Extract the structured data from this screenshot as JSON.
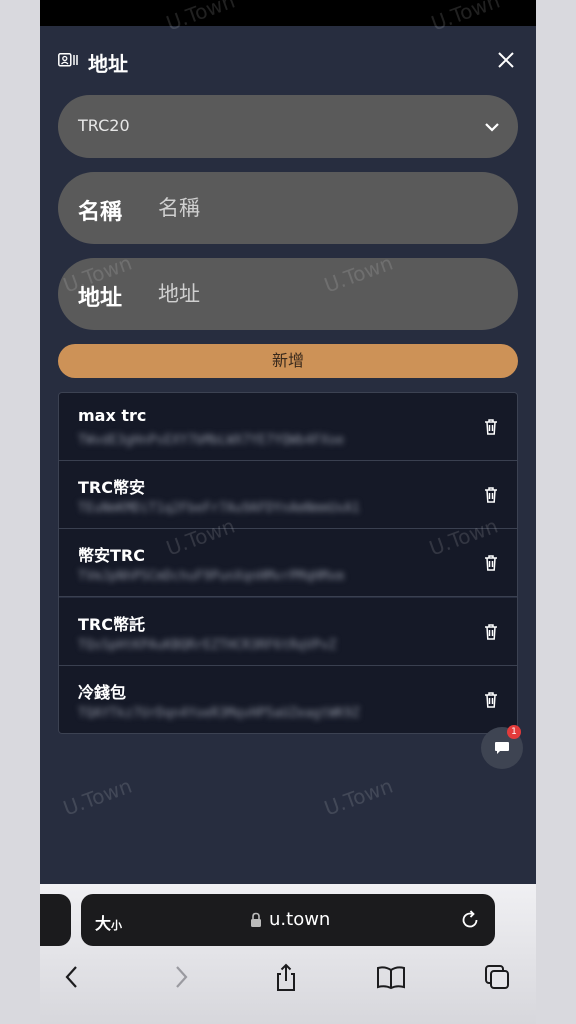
{
  "header": {
    "title": "地址",
    "icon": "address-card-icon",
    "close_icon": "close-icon"
  },
  "network_select": {
    "value": "TRC20"
  },
  "form": {
    "name_label": "名稱",
    "name_placeholder": "名稱",
    "address_label": "地址",
    "address_placeholder": "地址",
    "add_button": "新增"
  },
  "addresses": [
    {
      "name": "max trc",
      "address": "TWvdE3gHnPsEXY7bMbLWX7YE7YQWb4FXoe"
    },
    {
      "name": "TRC幣安",
      "address": "TEuNmKMDiT1q2FbeFr7Au9AFDYnAmNmmUxA1"
    },
    {
      "name": "幣安TRC",
      "address": "TVmJpNhPSCmDchuF9PunXqnHMvrPMqHMxm"
    },
    {
      "name": "TRC幣託",
      "address": "TQsSpHtKPAuKBQRrEZTHCR3RF6tRqVPvZ"
    },
    {
      "name": "冷錢包",
      "address": "TQAYTkz7UrDqn4YoeR3MqvHP5aUZeagtWK9Z"
    }
  ],
  "chat": {
    "badge": "1"
  },
  "watermark": "U.Town",
  "browser": {
    "aa_big": "大",
    "aa_small": "小",
    "url": "u.town"
  },
  "colors": {
    "accent": "#cd9257",
    "panel": "#272d3f",
    "row": "#151927",
    "badge": "#e23b3b"
  }
}
